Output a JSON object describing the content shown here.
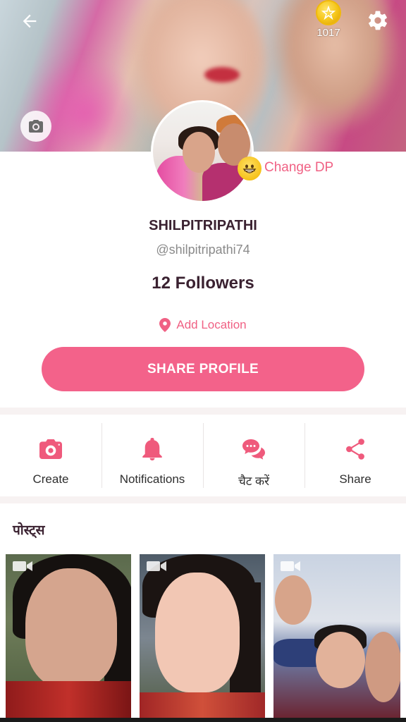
{
  "header": {
    "back_icon": "arrow-left-icon",
    "coins": "1017",
    "settings_icon": "gear-icon",
    "cover_camera_icon": "camera-icon"
  },
  "profile": {
    "change_dp_label": "Change DP",
    "name": "SHILPITRIPATHI",
    "handle": "@shilpitripathi74",
    "followers": "12 Followers",
    "location_label": "Add Location",
    "share_button_label": "SHARE PROFILE"
  },
  "actions": [
    {
      "label": "Create",
      "icon": "camera-icon"
    },
    {
      "label": "Notifications",
      "icon": "bell-icon"
    },
    {
      "label": "चैट करें",
      "icon": "chat-icon"
    },
    {
      "label": "Share",
      "icon": "share-icon"
    }
  ],
  "posts": {
    "title": "पोस्ट्स"
  },
  "colors": {
    "accent": "#f3628a",
    "accent_text": "#f06184",
    "title_text": "#3a2130"
  }
}
